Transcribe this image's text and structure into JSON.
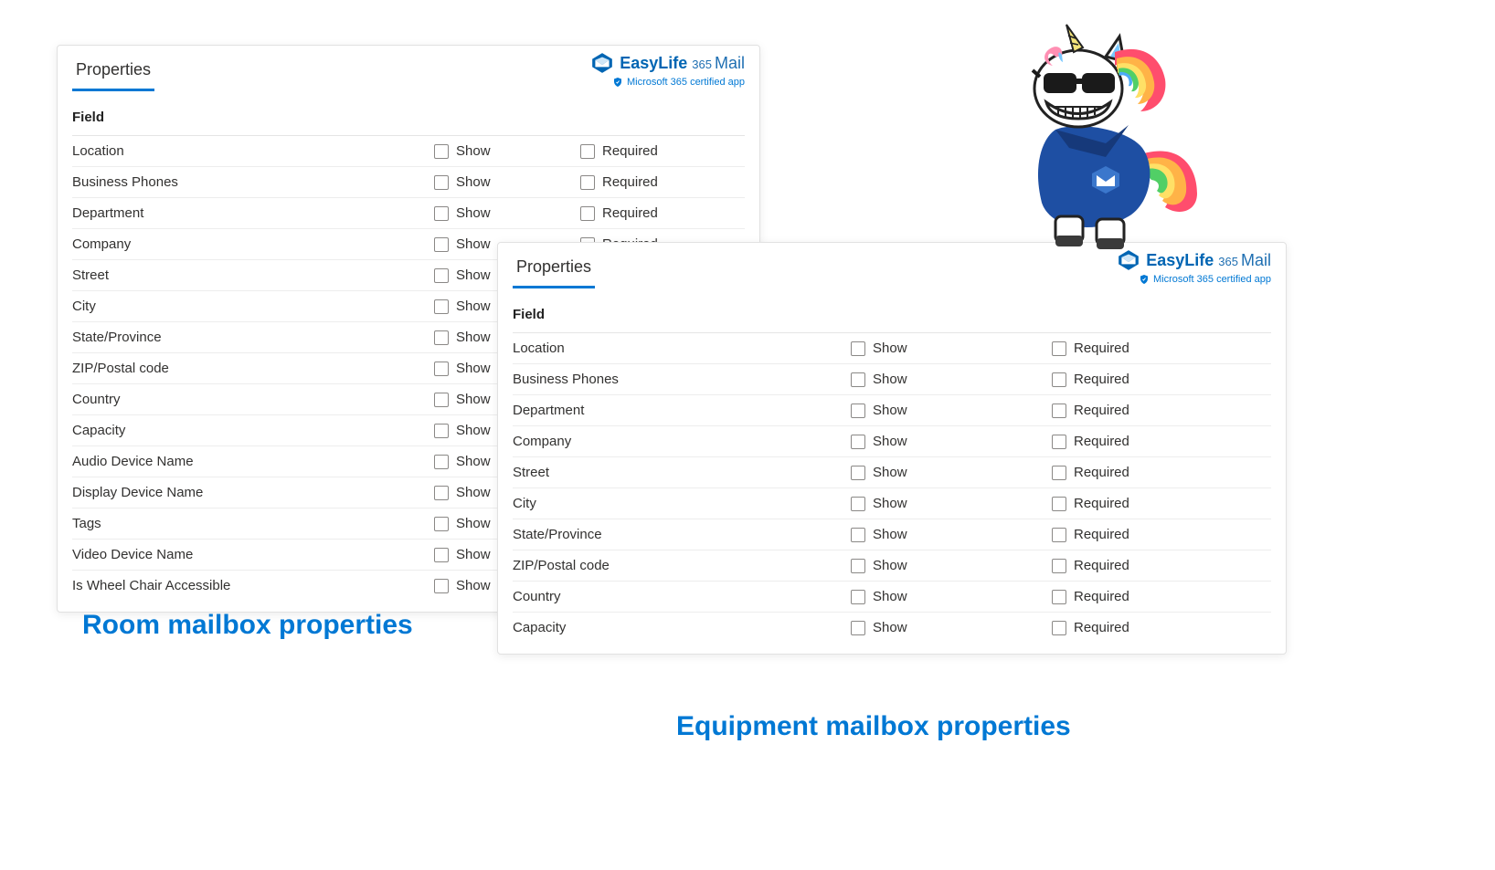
{
  "common": {
    "tab_label": "Properties",
    "brand_name": "EasyLife",
    "brand_365": "365",
    "brand_mail": "Mail",
    "certified": "Microsoft 365 certified app",
    "header_field": "Field",
    "show_label": "Show",
    "required_label": "Required"
  },
  "room": {
    "caption": "Room mailbox properties",
    "fields": [
      "Location",
      "Business Phones",
      "Department",
      "Company",
      "Street",
      "City",
      "State/Province",
      "ZIP/Postal code",
      "Country",
      "Capacity",
      "Audio Device Name",
      "Display Device Name",
      "Tags",
      "Video Device Name",
      "Is Wheel Chair Accessible"
    ]
  },
  "equip": {
    "caption": "Equipment mailbox properties",
    "fields": [
      "Location",
      "Business Phones",
      "Department",
      "Company",
      "Street",
      "City",
      "State/Province",
      "ZIP/Postal code",
      "Country",
      "Capacity"
    ]
  }
}
